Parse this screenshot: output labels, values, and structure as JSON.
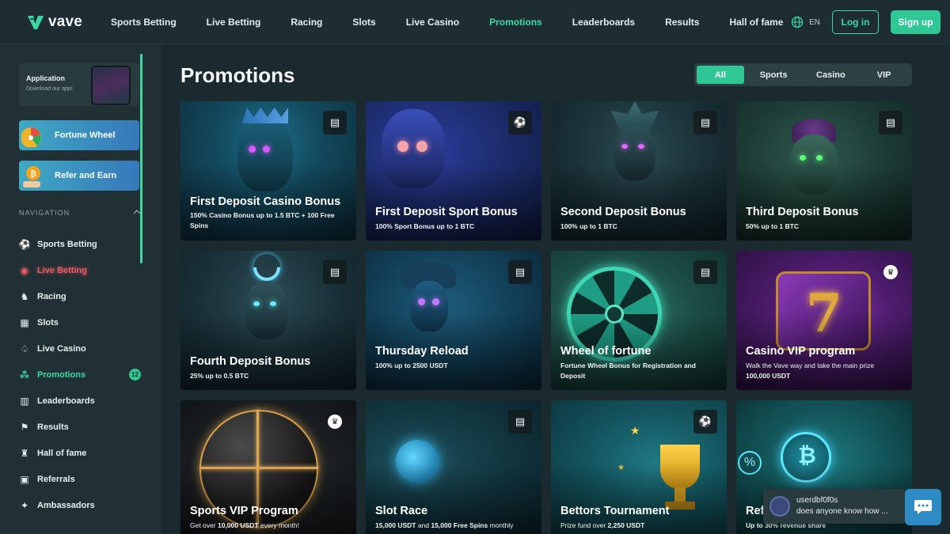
{
  "brand": {
    "name": "vave",
    "accent": "#3dd9a5"
  },
  "nav": [
    {
      "label": "Sports Betting",
      "active": false
    },
    {
      "label": "Live Betting",
      "active": false
    },
    {
      "label": "Racing",
      "active": false
    },
    {
      "label": "Slots",
      "active": false
    },
    {
      "label": "Live Casino",
      "active": false
    },
    {
      "label": "Promotions",
      "active": true
    },
    {
      "label": "Leaderboards",
      "active": false
    },
    {
      "label": "Results",
      "active": false
    },
    {
      "label": "Hall of fame",
      "active": false
    }
  ],
  "header": {
    "language": "EN",
    "login_label": "Log in",
    "signup_label": "Sign up"
  },
  "sidebar": {
    "app": {
      "title": "Application",
      "subtitle": "Download our app!"
    },
    "promos": [
      {
        "label": "Fortune Wheel",
        "icon": "fortune-wheel-icon"
      },
      {
        "label": "Refer and Earn",
        "icon": "coin-icon"
      }
    ],
    "nav_heading": "NAVIGATION",
    "items": [
      {
        "label": "Sports Betting",
        "icon": "soccer-ball-icon"
      },
      {
        "label": "Live Betting",
        "icon": "live-icon"
      },
      {
        "label": "Racing",
        "icon": "horse-icon"
      },
      {
        "label": "Slots",
        "icon": "slot-machine-icon"
      },
      {
        "label": "Live Casino",
        "icon": "cards-icon"
      },
      {
        "label": "Promotions",
        "icon": "promo-icon",
        "badge": "12"
      },
      {
        "label": "Leaderboards",
        "icon": "leaderboard-icon"
      },
      {
        "label": "Results",
        "icon": "flag-icon"
      },
      {
        "label": "Hall of fame",
        "icon": "trophy-person-icon"
      },
      {
        "label": "Referrals",
        "icon": "gift-icon"
      },
      {
        "label": "Ambassadors",
        "icon": "handshake-icon"
      }
    ]
  },
  "main": {
    "title": "Promotions",
    "filters": [
      "All",
      "Sports",
      "Casino",
      "VIP"
    ],
    "active_filter": "All",
    "cards": [
      {
        "title": "First Deposit Casino Bonus",
        "subtitle": "150% Casino Bonus up to 1.5 BTC + 100 Free Spins",
        "icon": "slot-icon"
      },
      {
        "title": "First Deposit Sport Bonus",
        "subtitle": "100% Sport Bonus up to 1 BTC",
        "icon": "soccer-ball-icon"
      },
      {
        "title": "Second Deposit Bonus",
        "subtitle": "100% up to 1 BTC",
        "icon": "slot-icon"
      },
      {
        "title": "Third Deposit Bonus",
        "subtitle": "50% up to 1 BTC",
        "icon": "slot-icon"
      },
      {
        "title": "Fourth Deposit Bonus",
        "subtitle": "25% up to 0.5 BTC",
        "icon": "slot-icon"
      },
      {
        "title": "Thursday Reload",
        "subtitle": "100% up to 2500 USDT",
        "icon": "slot-icon"
      },
      {
        "title": "Wheel of fortune",
        "subtitle": "Fortune Wheel Bonus for Registration and Deposit",
        "icon": "slot-icon"
      },
      {
        "title": "Casino VIP program",
        "subtitle": "Walk the Vave way and take the main prize",
        "subtitle2": "100,000 USDT",
        "icon": "crown-icon"
      },
      {
        "title": "Sports VIP Program",
        "subtitle_prefix": "Get over ",
        "subtitle_bold": "10,000 USDT",
        "subtitle_suffix": " every month!",
        "icon": "crown-icon"
      },
      {
        "title": "Slot Race",
        "subtitle_bold": "15,000 USDT",
        "subtitle_mid": " and ",
        "subtitle_bold2": "15,000 Free Spins",
        "subtitle_suffix": " monthly",
        "icon": "slot-icon"
      },
      {
        "title": "Bettors Tournament",
        "subtitle_prefix": "Prize fund over ",
        "subtitle_bold": "2,250 USDT",
        "icon": "soccer-ball-icon"
      },
      {
        "title": "Ref",
        "subtitle": "Up to 30% revenue share",
        "icon": "none"
      }
    ]
  },
  "chat": {
    "user": "userdbf0f0s",
    "message": "does anyone know how ..."
  }
}
